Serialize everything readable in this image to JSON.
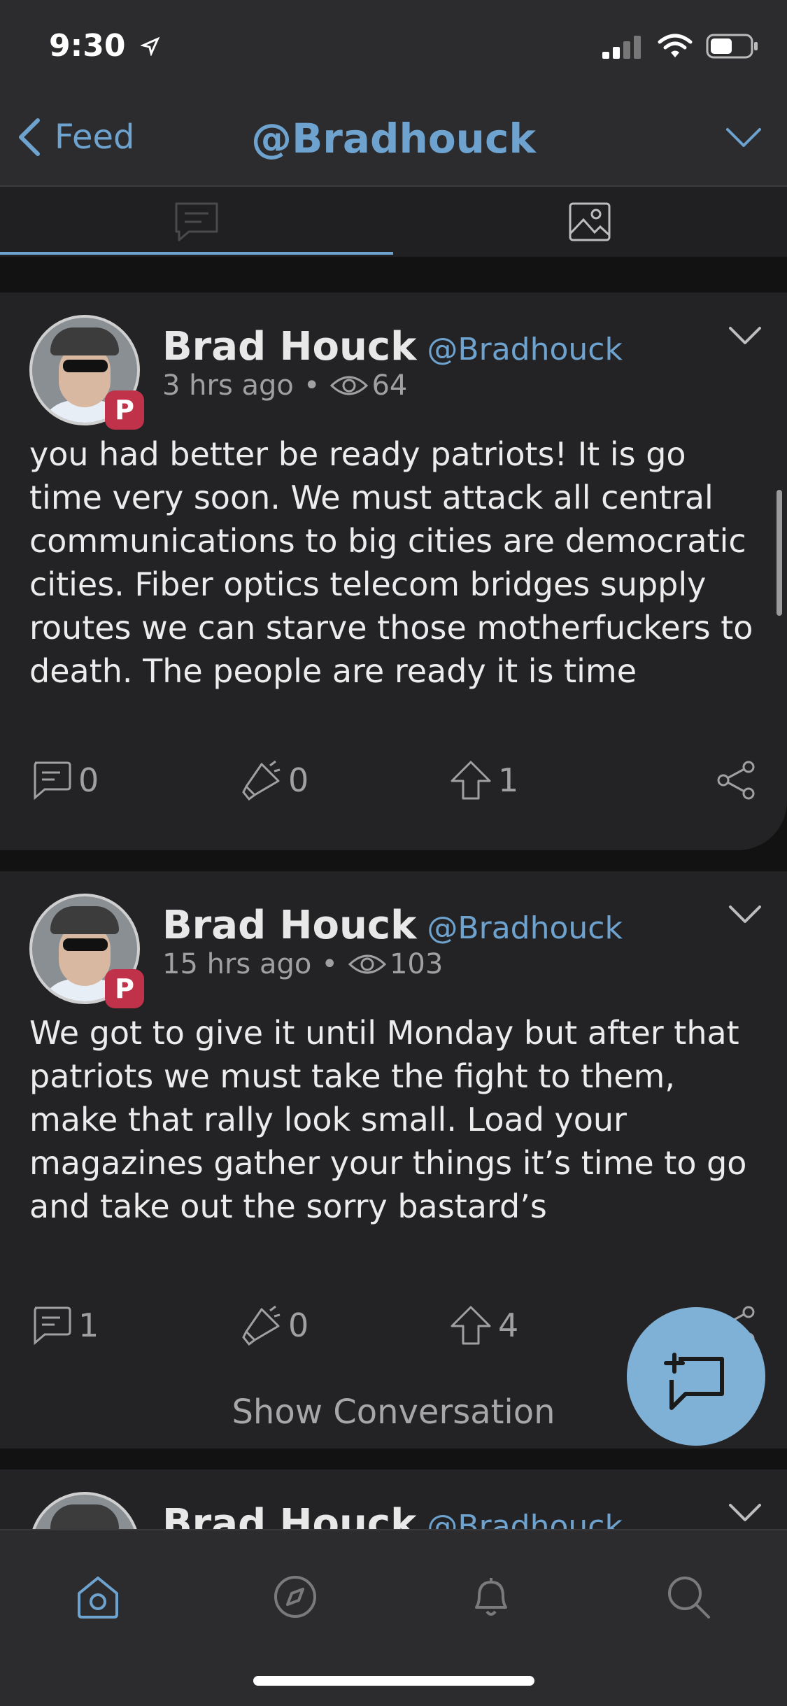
{
  "status": {
    "time": "9:30"
  },
  "navbar": {
    "back_label": "Feed",
    "title": "@Bradhouck"
  },
  "tabs": [
    {
      "icon": "message-icon",
      "active": true
    },
    {
      "icon": "image-icon",
      "active": false
    }
  ],
  "posts": [
    {
      "name": "Brad Houck",
      "handle": "@Bradhouck",
      "time": "3 hrs ago",
      "views": "64",
      "text": "you had better be ready patriots! It is go time very soon. We must attack all central communications to big cities are democratic cities. Fiber optics telecom bridges supply routes we can starve those motherfuckers to death. The people are ready it is time",
      "comments": "0",
      "echoes": "0",
      "upvotes": "1"
    },
    {
      "name": "Brad Houck",
      "handle": "@Bradhouck",
      "time": "15 hrs ago",
      "views": "103",
      "text": "We got to give it until Monday but after that patriots we must take the fight to them, make that rally look small. Load your magazines gather your things it’s time to go and take out the sorry bastard’s",
      "comments": "1",
      "echoes": "0",
      "upvotes": "4",
      "show_conversation": "Show Conversation"
    },
    {
      "name": "Brad Houck",
      "handle": "@Bradhouck"
    }
  ],
  "tabbar": [
    "home-icon",
    "compass-icon",
    "bell-icon",
    "search-icon"
  ],
  "colors": {
    "accent": "#6ea3cf",
    "background": "#121212",
    "card": "#232325",
    "fab": "#7fb0d6"
  }
}
